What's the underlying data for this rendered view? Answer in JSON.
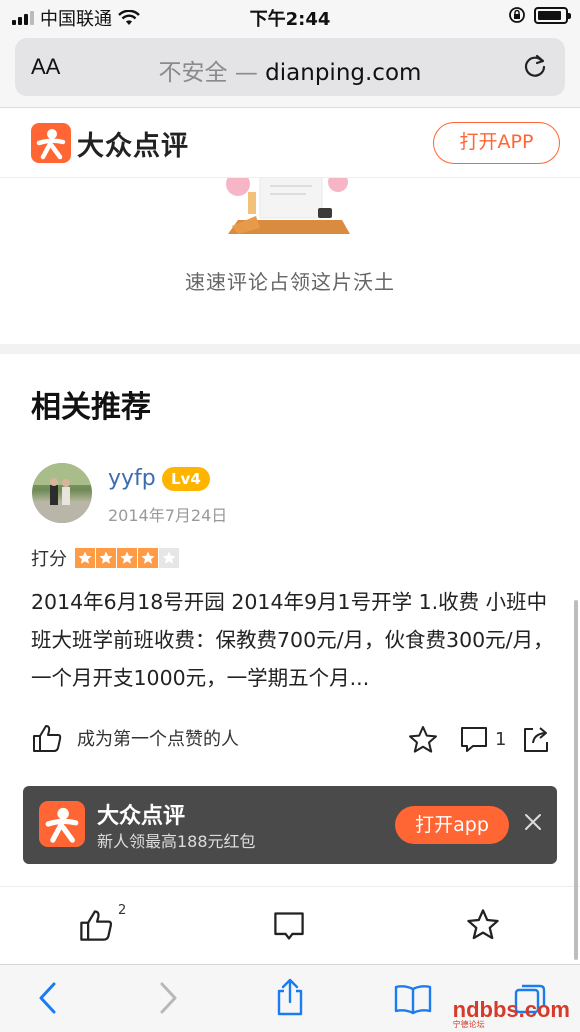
{
  "status_bar": {
    "carrier": "中国联通",
    "time": "下午2:44"
  },
  "address_bar": {
    "aa_label": "AA",
    "insecure_label": "不安全 —",
    "domain": "dianping.com"
  },
  "site_header": {
    "logo_text": "大众点评",
    "open_app_label": "打开APP"
  },
  "empty_comments": {
    "text": "速速评论占领这片沃土"
  },
  "recommend": {
    "title": "相关推荐",
    "review": {
      "username": "yyfp",
      "level": "Lv4",
      "date": "2014年7月24日",
      "score_label": "打分",
      "rating": 4,
      "rating_max": 5,
      "text": "2014年6月18号开园 2014年9月1号开学 1.收费 小班中班大班学前班收费：保教费700元/月，伙食费300元/月，一个月开支1000元，一学期五个月...",
      "like_prompt": "成为第一个点赞的人",
      "comment_count": "1"
    }
  },
  "promo_banner": {
    "title": "大众点评",
    "subtitle": "新人领最高188元红包",
    "button_label": "打开app"
  },
  "page_bottom_bar": {
    "like_count": "2"
  },
  "watermark": {
    "text": "ndbbs.com",
    "subtext": "宁德论坛"
  },
  "colors": {
    "brand": "#ff6633",
    "banner_bg": "#4a4a4a",
    "level_badge": "#ffb400",
    "username": "#3a6db0",
    "star": "#ff9a45"
  }
}
